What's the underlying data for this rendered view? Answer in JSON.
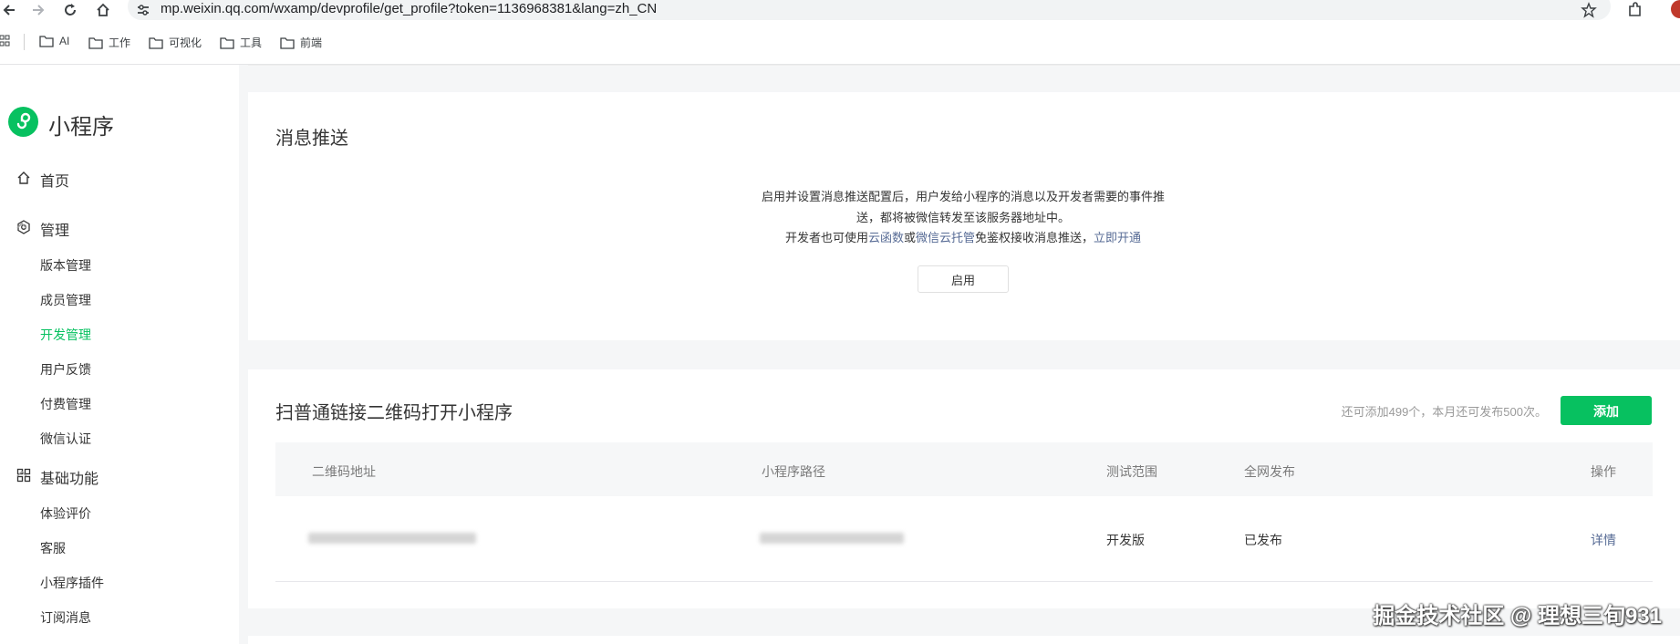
{
  "browser": {
    "url": "mp.weixin.qq.com/wxamp/devprofile/get_profile?token=1136968381&lang=zh_CN",
    "bookmarks": [
      "AI",
      "工作",
      "可视化",
      "工具",
      "前端"
    ]
  },
  "sidebar": {
    "logo_text": "小程序",
    "home_label": "首页",
    "sections": [
      {
        "label": "管理",
        "items": [
          "版本管理",
          "成员管理",
          "开发管理",
          "用户反馈",
          "付费管理",
          "微信认证"
        ]
      },
      {
        "label": "基础功能",
        "items": [
          "体验评价",
          "客服",
          "小程序插件",
          "订阅消息"
        ]
      }
    ],
    "active_item": "开发管理"
  },
  "message_push": {
    "title": "消息推送",
    "desc_line1": "启用并设置消息推送配置后，用户发给小程序的消息以及开发者需要的事件推",
    "desc_line2": "送，都将被微信转发至该服务器地址中。",
    "desc_line3_prefix": "开发者也可使用",
    "link_cloud_func": "云函数",
    "conj_or": "或",
    "link_cloud_hosting": "微信云托管",
    "desc_line3_suffix": "免鉴权接收消息推送，",
    "link_enable_now": "立即开通",
    "enable_button": "启用"
  },
  "qr_link": {
    "title": "扫普通链接二维码打开小程序",
    "quota_text": "还可添加499个，本月还可发布500次。",
    "add_button": "添加",
    "columns": [
      "二维码地址",
      "小程序路径",
      "测试范围",
      "全网发布",
      "操作"
    ],
    "rows": [
      {
        "qr_url": "",
        "path": "",
        "test_scope": "开发版",
        "publish": "已发布",
        "action": "详情"
      }
    ]
  },
  "watermark": "掘金技术社区 @ 理想三旬931",
  "colors": {
    "accent": "#07c160",
    "link": "#576b95",
    "background": "#f5f6f7"
  }
}
